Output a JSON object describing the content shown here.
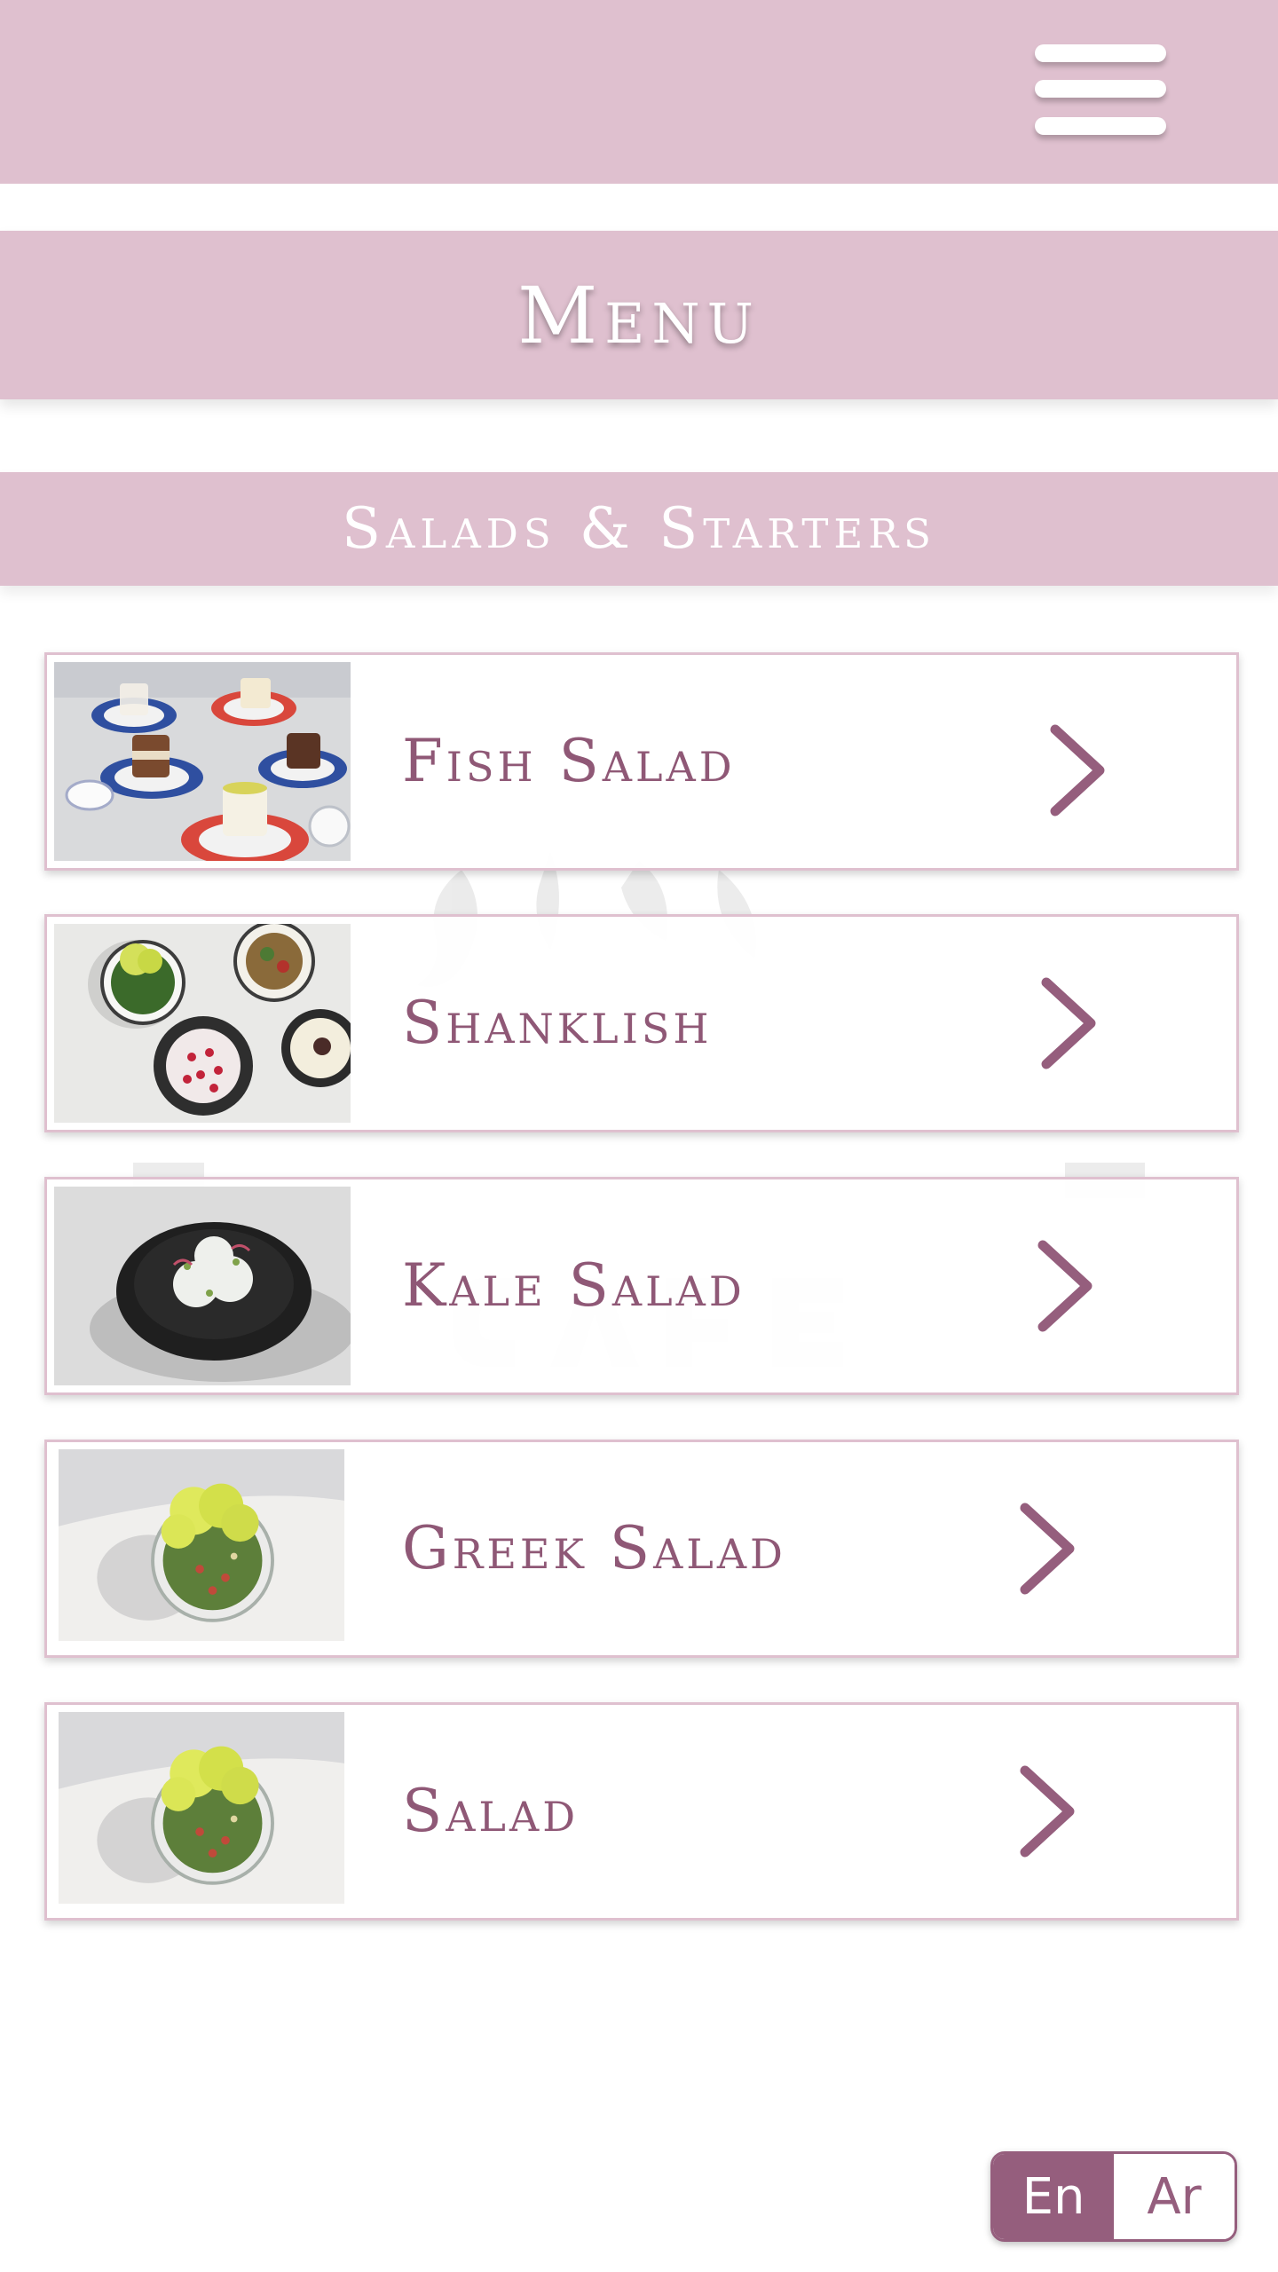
{
  "header": {
    "menu_button_icon": "hamburger-icon"
  },
  "page": {
    "title": "Menu",
    "section_title": "Salads & Starters"
  },
  "items": [
    {
      "name": "Fish Salad",
      "image": "desserts-jars-photo"
    },
    {
      "name": "Shanklish",
      "image": "mezze-plates-photo"
    },
    {
      "name": "Kale Salad",
      "image": "black-bowl-photo"
    },
    {
      "name": "Greek Salad",
      "image": "tabbouleh-bowl-photo"
    },
    {
      "name": "Salad",
      "image": "tabbouleh-bowl-photo"
    }
  ],
  "language": {
    "en_label": "En",
    "ar_label": "Ar",
    "selected": "En"
  },
  "colors": {
    "banner": "#dfc0cf",
    "accent": "#955e7d",
    "item_text": "#8f5876"
  }
}
